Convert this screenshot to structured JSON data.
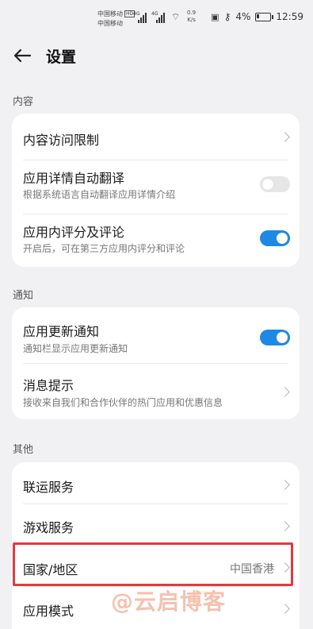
{
  "status_bar": {
    "carrier1": "中国移动",
    "hd": "HD",
    "carrier2": "中国移动",
    "network1": "4G",
    "network2": "4G",
    "speed_value": "0.9",
    "speed_unit": "K/s",
    "battery": "4%",
    "time": "12:59"
  },
  "header": {
    "title": "设置"
  },
  "sections": {
    "content": {
      "title": "内容",
      "items": [
        {
          "label": "内容访问限制"
        },
        {
          "label": "应用详情自动翻译",
          "sub": "根据系统语言自动翻译应用详情介绍",
          "toggle": false
        },
        {
          "label": "应用内评分及评论",
          "sub": "开启后，可在第三方应用内评分和评论",
          "toggle": true
        }
      ]
    },
    "notify": {
      "title": "通知",
      "items": [
        {
          "label": "应用更新通知",
          "sub": "通知栏显示应用更新通知",
          "toggle": true
        },
        {
          "label": "消息提示",
          "sub": "接收来自我们和合作伙伴的热门应用和优惠信息"
        }
      ]
    },
    "other": {
      "title": "其他",
      "items": [
        {
          "label": "联运服务"
        },
        {
          "label": "游戏服务"
        },
        {
          "label": "国家/地区",
          "value": "中国香港"
        },
        {
          "label": "应用模式"
        }
      ]
    }
  },
  "watermark": "@云启博客",
  "colors": {
    "accent": "#1e88e5",
    "highlight": "#e4393c"
  }
}
